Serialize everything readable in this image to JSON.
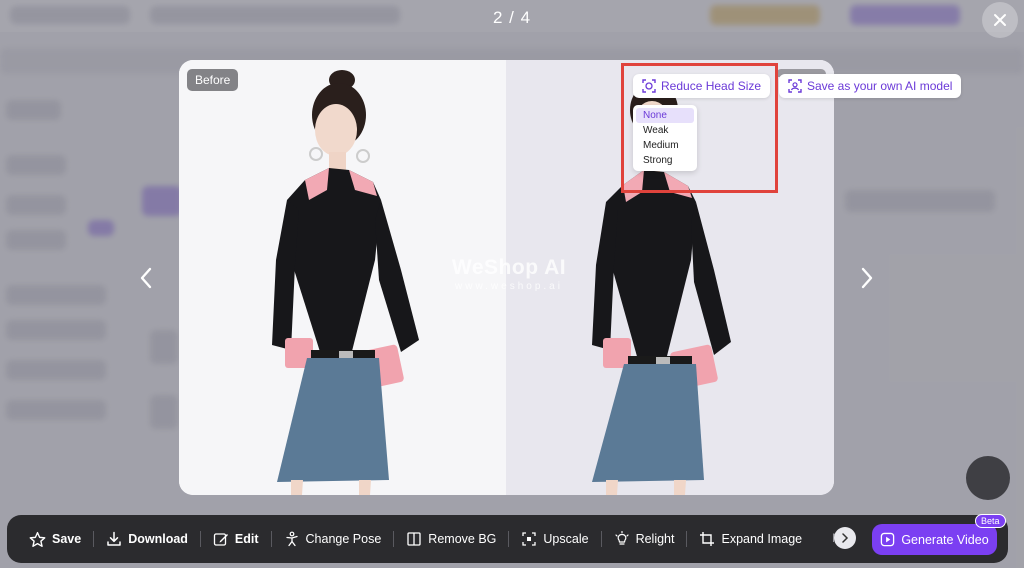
{
  "viewer": {
    "counter": "2 / 4",
    "before_label": "Before",
    "watermark": {
      "brand": "WeShop AI",
      "url": "www.weshop.ai"
    }
  },
  "image_actions": {
    "reduce_head": {
      "label": "Reduce Head Size",
      "icon": "face-frame-icon"
    },
    "save_model": {
      "label": "Save as your own AI model",
      "icon": "face-scan-icon"
    }
  },
  "head_size_options": [
    "None",
    "Weak",
    "Medium",
    "Strong"
  ],
  "head_size_selected": "None",
  "toolbar": {
    "items": [
      {
        "label": "Save",
        "icon": "star-icon"
      },
      {
        "label": "Download",
        "icon": "download-icon"
      },
      {
        "label": "Edit",
        "icon": "edit-icon"
      },
      {
        "label": "Change Pose",
        "icon": "pose-icon"
      },
      {
        "label": "Remove BG",
        "icon": "split-icon"
      },
      {
        "label": "Upscale",
        "icon": "upscale-icon"
      },
      {
        "label": "Relight",
        "icon": "bulb-icon"
      },
      {
        "label": "Expand Image",
        "icon": "crop-icon"
      }
    ],
    "faded_label": "M",
    "generate_video": "Generate Video",
    "beta": "Beta"
  },
  "colors": {
    "accent": "#7b3ff2",
    "highlight": "#e0433c",
    "toolbar_bg": "#2b2b2e"
  }
}
